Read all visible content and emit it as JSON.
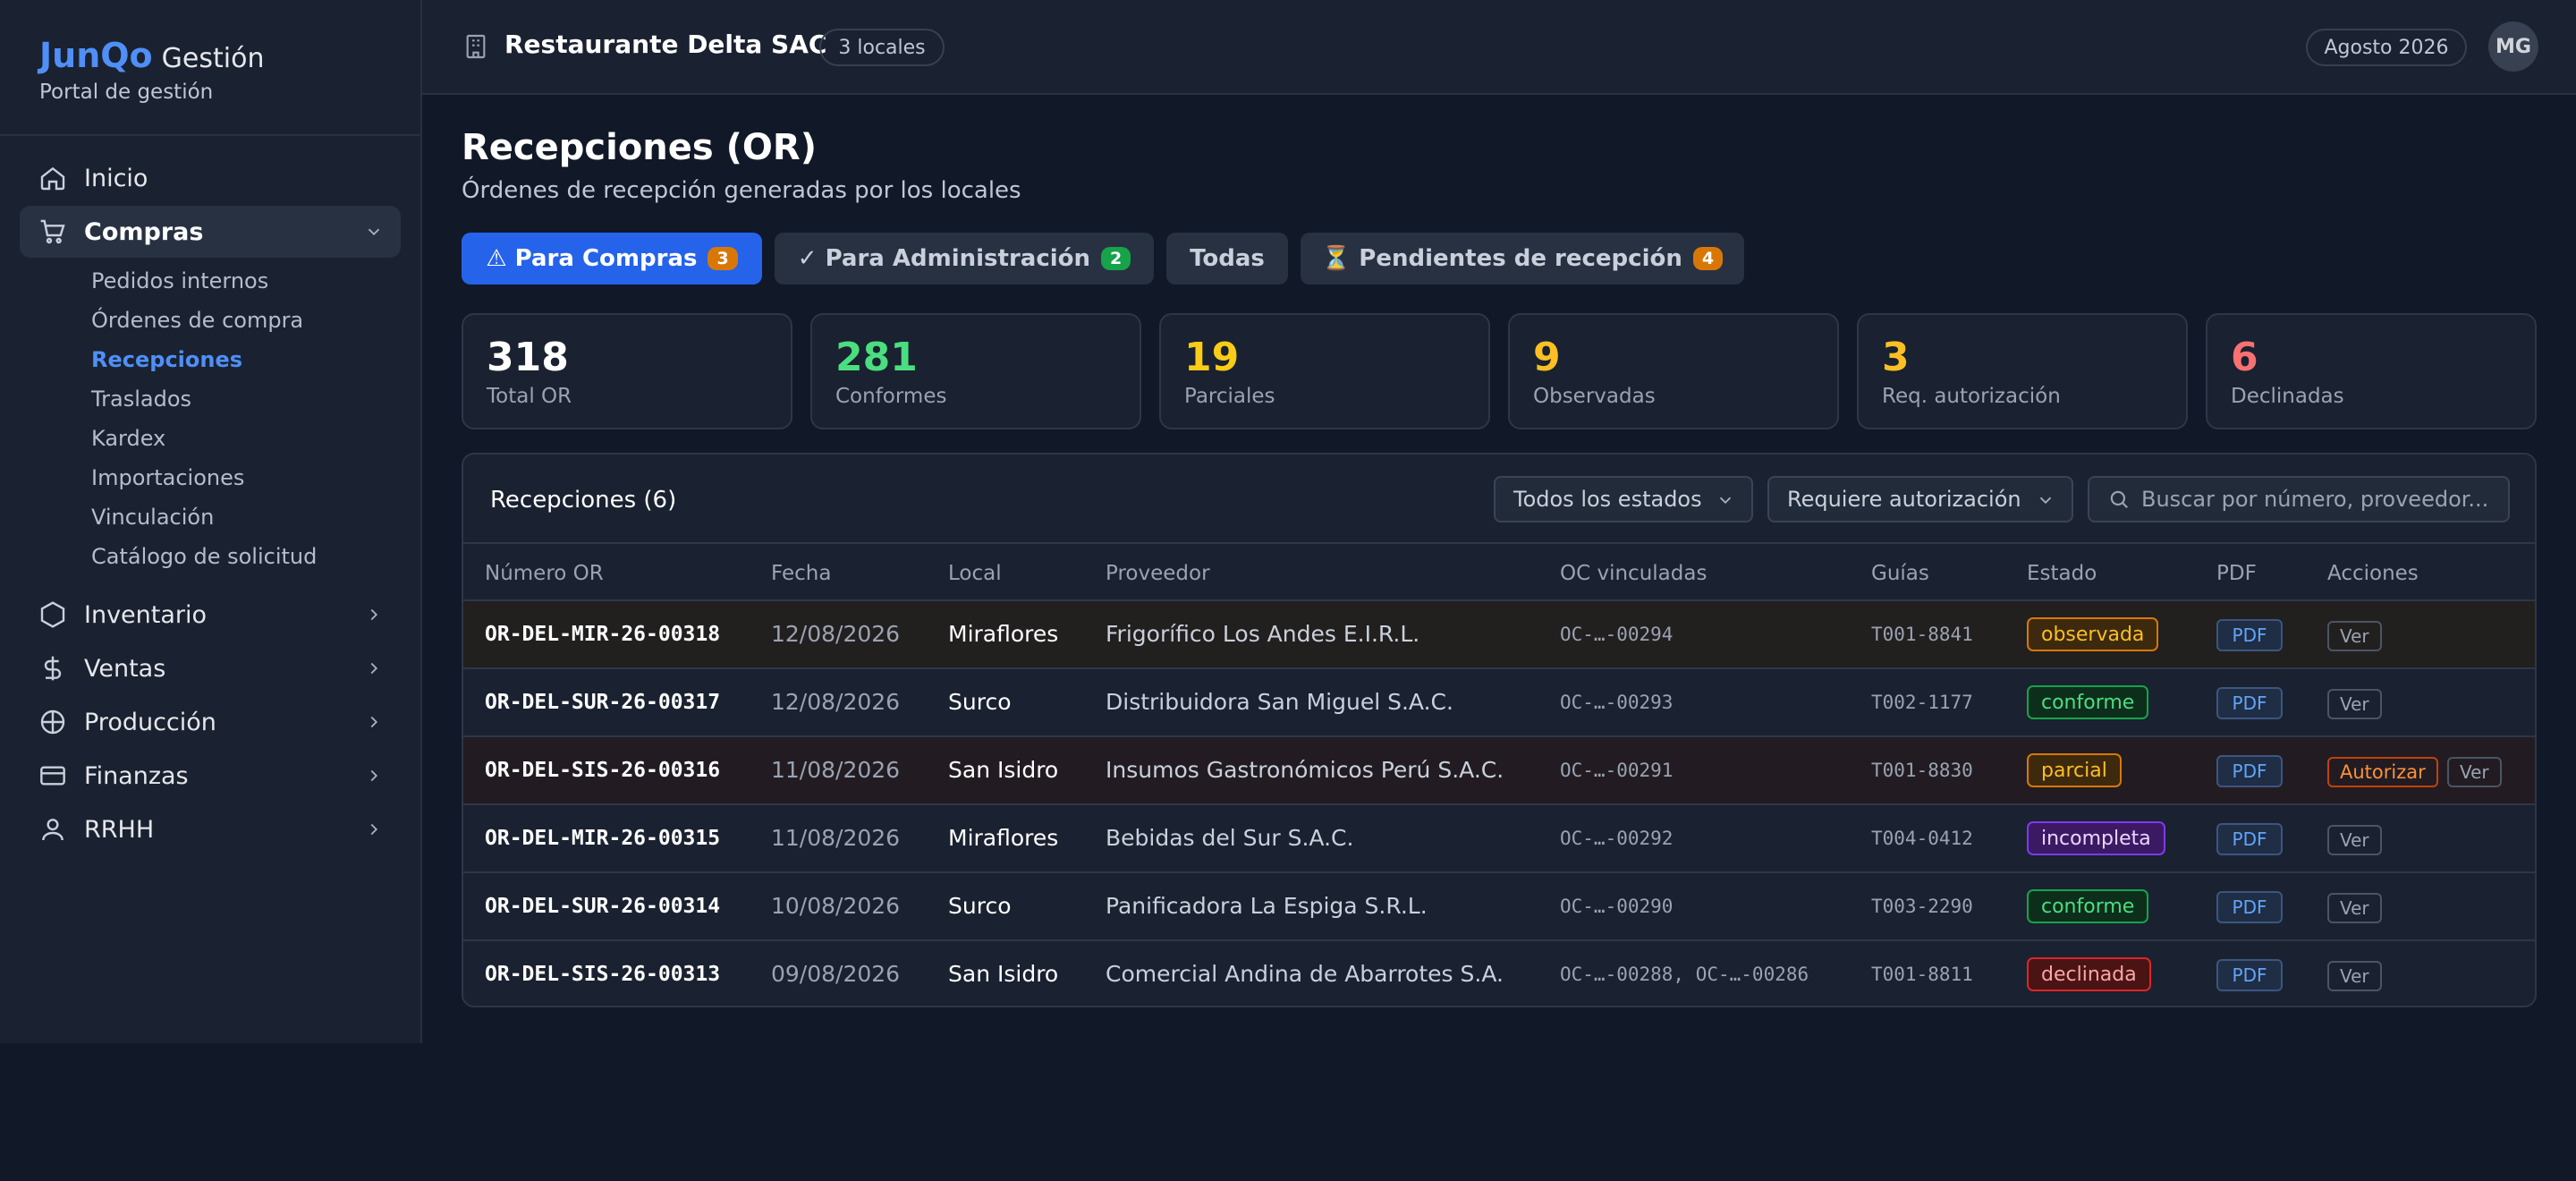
{
  "brand": {
    "name": "JunQo",
    "suffix": "Gestión",
    "tagline": "Portal de gestión"
  },
  "sidebar": {
    "items": [
      {
        "label": "Inicio",
        "icon": "home-icon"
      },
      {
        "label": "Compras",
        "icon": "cart-icon",
        "expanded": true
      },
      {
        "label": "Inventario",
        "icon": "hexagon-icon"
      },
      {
        "label": "Ventas",
        "icon": "dollar-icon"
      },
      {
        "label": "Producción",
        "icon": "globe-icon"
      },
      {
        "label": "Finanzas",
        "icon": "card-icon"
      },
      {
        "label": "RRHH",
        "icon": "user-icon"
      }
    ],
    "compras_sub": [
      "Pedidos internos",
      "Órdenes de compra",
      "Recepciones",
      "Traslados",
      "Kardex",
      "Importaciones",
      "Vinculación",
      "Catálogo de solicitud"
    ]
  },
  "topbar": {
    "company": "Restaurante Delta SAC",
    "locales": "3 locales",
    "period": "Agosto 2026",
    "avatar": "MG"
  },
  "page": {
    "title": "Recepciones (OR)",
    "subtitle": "Órdenes de recepción generadas por los locales"
  },
  "tabs": [
    {
      "label": "⚠ Para Compras",
      "badge": "3",
      "badge_color": "#d97706"
    },
    {
      "label": "✓ Para Administración",
      "badge": "2",
      "badge_color": "#16a34a"
    },
    {
      "label": "Todas",
      "badge": ""
    },
    {
      "label": "⏳ Pendientes de recepción",
      "badge": "4",
      "badge_color": "#d97706"
    }
  ],
  "stats": [
    {
      "value": "318",
      "label": "Total OR",
      "color": "#ffffff"
    },
    {
      "value": "281",
      "label": "Conformes",
      "color": "#4ade80"
    },
    {
      "value": "19",
      "label": "Parciales",
      "color": "#facc15"
    },
    {
      "value": "9",
      "label": "Observadas",
      "color": "#fbbf24"
    },
    {
      "value": "3",
      "label": "Req. autorización",
      "color": "#fbbf24"
    },
    {
      "value": "6",
      "label": "Declinadas",
      "color": "#f87171"
    }
  ],
  "table": {
    "title": "Recepciones (6)",
    "filter_status": "Todos los estados",
    "filter_auth": "Requiere autorización",
    "search_placeholder": "Buscar por número, proveedor...",
    "columns": [
      "Número OR",
      "Fecha",
      "Local",
      "Proveedor",
      "OC vinculadas",
      "Guías",
      "Estado",
      "PDF",
      "Acciones"
    ],
    "pdf_label": "PDF",
    "ver_label": "Ver",
    "autorizar_label": "Autorizar",
    "rows": [
      {
        "num": "OR-DEL-MIR-26-00318",
        "date": "12/08/2026",
        "local": "Miraflores",
        "prov": "Frigorífico Los Andes E.I.R.L.",
        "oc": "OC-…-00294",
        "guia": "T001-8841",
        "status": "observada"
      },
      {
        "num": "OR-DEL-SUR-26-00317",
        "date": "12/08/2026",
        "local": "Surco",
        "prov": "Distribuidora San Miguel S.A.C.",
        "oc": "OC-…-00293",
        "guia": "T002-1177",
        "status": "conforme"
      },
      {
        "num": "OR-DEL-SIS-26-00316",
        "date": "11/08/2026",
        "local": "San Isidro",
        "prov": "Insumos Gastronómicos Perú S.A.C.",
        "oc": "OC-…-00291",
        "guia": "T001-8830",
        "status": "parcial"
      },
      {
        "num": "OR-DEL-MIR-26-00315",
        "date": "11/08/2026",
        "local": "Miraflores",
        "prov": "Bebidas del Sur S.A.C.",
        "oc": "OC-…-00292",
        "guia": "T004-0412",
        "status": "incompleta"
      },
      {
        "num": "OR-DEL-SUR-26-00314",
        "date": "10/08/2026",
        "local": "Surco",
        "prov": "Panificadora La Espiga S.R.L.",
        "oc": "OC-…-00290",
        "guia": "T003-2290",
        "status": "conforme"
      },
      {
        "num": "OR-DEL-SIS-26-00313",
        "date": "09/08/2026",
        "local": "San Isidro",
        "prov": "Comercial Andina de Abarrotes S.A.",
        "oc": "OC-…-00288, OC-…-00286",
        "guia": "T001-8811",
        "status": "declinada"
      }
    ]
  }
}
